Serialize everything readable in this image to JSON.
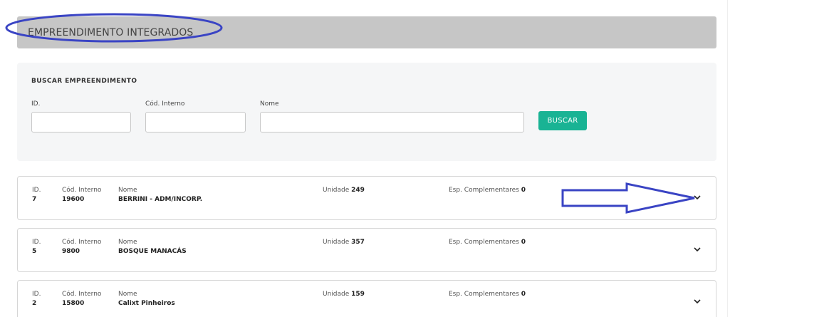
{
  "page": {
    "title": "EMPREENDIMENTO INTEGRADOS"
  },
  "search": {
    "heading": "BUSCAR EMPREENDIMENTO",
    "id_label": "ID.",
    "id_value": "",
    "code_label": "Cód. Interno",
    "code_value": "",
    "name_label": "Nome",
    "name_value": "",
    "button_label": "BUSCAR"
  },
  "results": {
    "labels": {
      "id": "ID.",
      "code": "Cód. Interno",
      "name": "Nome",
      "units": "Unidade",
      "complementary": "Esp. Complementares"
    },
    "rows": [
      {
        "id": "7",
        "code": "19600",
        "name": "BERRINI - ADM/INCORP.",
        "units": "249",
        "complementary": "0"
      },
      {
        "id": "5",
        "code": "9800",
        "name": "BOSQUE MANACÁS",
        "units": "357",
        "complementary": "0"
      },
      {
        "id": "2",
        "code": "15800",
        "name": "Calixt Pinheiros",
        "units": "159",
        "complementary": "0"
      }
    ]
  },
  "icons": {
    "expand": "chevron-down-icon"
  },
  "colors": {
    "header_bg": "#c6c6c6",
    "panel_bg": "#f5f6f7",
    "button_bg": "#19b394",
    "annotation": "#3a44c4"
  }
}
